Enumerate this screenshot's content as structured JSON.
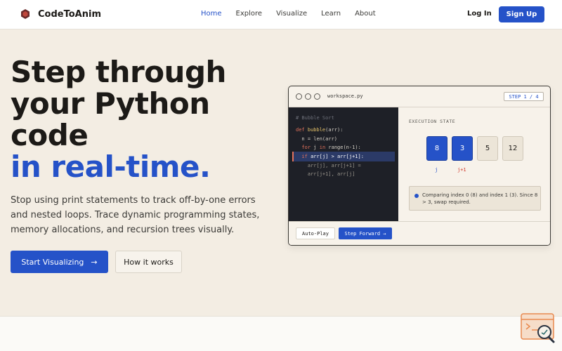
{
  "nav": {
    "brand": "CodeToAnim",
    "links": [
      "Home",
      "Explore",
      "Visualize",
      "Learn",
      "About"
    ],
    "active_link": "Home",
    "login": "Log In",
    "signup": "Sign Up"
  },
  "hero": {
    "title_line1": "Step through",
    "title_line2": "your Python",
    "title_line3": "code",
    "title_accent": "in real-time.",
    "subtitle": "Stop using print statements to track off-by-one errors and nested loops. Trace dynamic programming states, memory allocations, and recursion trees visually.",
    "primary_cta": "Start Visualizing",
    "primary_cta_icon": "→",
    "secondary_cta": "How it works"
  },
  "workspace": {
    "filename": "workspace.py",
    "step_indicator": "STEP 1 / 4",
    "code": {
      "comment": "# Bubble Sort",
      "l1_kw": "def ",
      "l1_fn": "bubble",
      "l1_rest": "(arr):",
      "l2": "  n = len(arr)",
      "l3_kw": "  for ",
      "l3_rest": "j ",
      "l3_kw2": "in ",
      "l3_rest2": "range(n-1):",
      "l4_kw": "  if ",
      "l4_rest": "arr[j] > arr[j+1]:",
      "l5": "    arr[j], arr[j+1] =",
      "l6": "    arr[j+1], arr[j]"
    },
    "state": {
      "label": "EXECUTION STATE",
      "cells": [
        "8",
        "3",
        "5",
        "12"
      ],
      "pointer_j": "j",
      "pointer_j1": "j+1",
      "message": "Comparing index 0 (8) and index 1 (3). Since 8 > 3, swap required."
    },
    "autoplay": "Auto-Play",
    "step_forward": "Step Forward →"
  },
  "colors": {
    "accent": "#2552c8",
    "background": "#f3ede3",
    "code_bg": "#1e2027",
    "keyword": "#e2725b",
    "highlight": "#2b3a67"
  }
}
